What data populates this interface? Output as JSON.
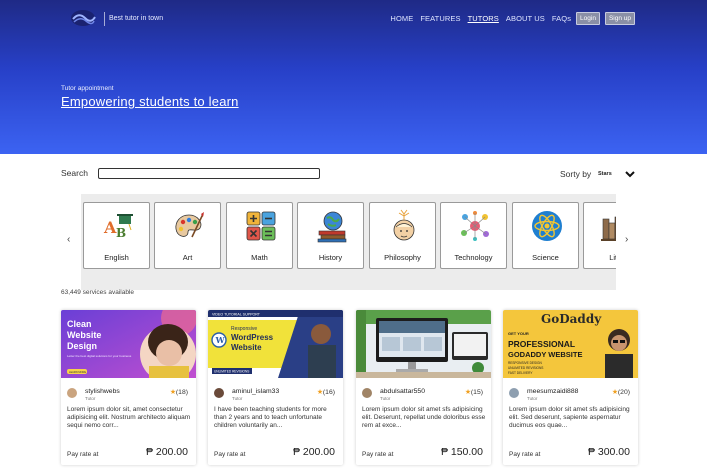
{
  "header": {
    "tagline": "Best tutor in town",
    "nav": [
      "HOME",
      "FEATURES",
      "TUTORS",
      "ABOUT US",
      "FAQs"
    ],
    "login_label": "Login",
    "signup_label": "Sign up"
  },
  "hero": {
    "subtitle": "Tutor appointment",
    "title": "Empowering students to learn"
  },
  "search": {
    "label": "Search",
    "value": ""
  },
  "sort": {
    "label": "Sorty by",
    "value": "Stars"
  },
  "categories": [
    {
      "label": "English",
      "icon": "english-icon"
    },
    {
      "label": "Art",
      "icon": "art-palette-icon"
    },
    {
      "label": "Math",
      "icon": "math-icon"
    },
    {
      "label": "History",
      "icon": "history-icon"
    },
    {
      "label": "Philosophy",
      "icon": "philosophy-icon"
    },
    {
      "label": "Technology",
      "icon": "technology-icon"
    },
    {
      "label": "Science",
      "icon": "science-icon"
    },
    {
      "label": "Liter",
      "icon": "literature-icon"
    }
  ],
  "services_count": "63,449 services available",
  "cards": [
    {
      "user": "stylishwebs",
      "role": "Tutor",
      "rating": "(18)",
      "description": "Lorem ipsum dolor sit, amet consectetur adipisicing elit. Nostrum architecto aliquam sequi nemo corr...",
      "pay_label": "Pay rate at",
      "price": "₱ 200.00",
      "thumb": {
        "line1": "Clean",
        "line2": "Website",
        "line3": "Design",
        "line4": "Letter the best digital solutions for your business",
        "cta": "LEARN MORE"
      }
    },
    {
      "user": "aminul_islam33",
      "role": "Tutor",
      "rating": "(16)",
      "description": "I have been teaching students for more than 2 years and to teach unfortunate children voluntarily an...",
      "pay_label": "Pay rate at",
      "price": "₱ 200.00",
      "thumb": {
        "top": "VIDEO TUTORIAL SUPPORT",
        "line1": "Responsive",
        "line2": "WordPress",
        "line3": "Website",
        "bottom": "UNLIMITED REVISIONS"
      }
    },
    {
      "user": "abdulsattar550",
      "role": "Tutor",
      "rating": "(15)",
      "description": "Lorem ipsum dolor sit amet sfs adipisicing elit. Deserunt, repellat unde doloribus esse rem at exce...",
      "pay_label": "Pay rate at",
      "price": "₱ 150.00",
      "thumb": {}
    },
    {
      "user": "meesumzaidi888",
      "role": "Tutor",
      "rating": "(20)",
      "description": "Lorem ipsum dolor sit amet sfs adipisicing elit. Sed deserunt, sapiente aspernatur ducimus eos quae...",
      "pay_label": "Pay rate at",
      "price": "₱ 300.00",
      "thumb": {
        "brand": "GoDaddy",
        "top": "GET YOUR",
        "line1": "PROFESSIONAL",
        "line2": "GODADDY WEBSITE",
        "line3": "RESPONSIVE DESIGN",
        "line4": "UNLIMITED REVISIONS",
        "line5": "FAST DELIVERY"
      }
    }
  ],
  "colors": {
    "hero_top": "#1f2a86",
    "hero_bottom": "#3c63f2",
    "star": "#f0a020"
  }
}
